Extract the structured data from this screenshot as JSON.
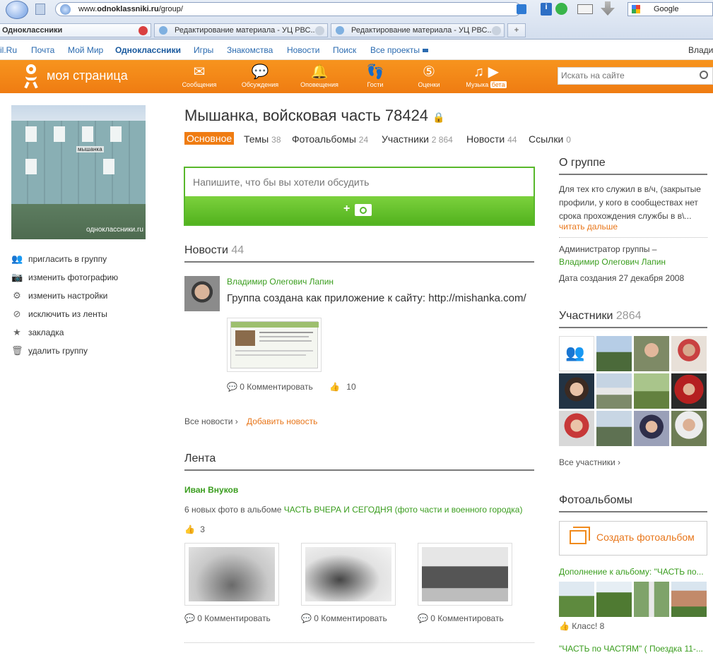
{
  "browser": {
    "url_prefix": "www.",
    "url_domain": "odnoklassniki.ru",
    "url_path": "/group/",
    "search_engine": "Google",
    "tabs": [
      {
        "label": "Одноклассники"
      },
      {
        "label": "Редактирование материала - УЦ РВС..."
      },
      {
        "label": "Редактирование материала - УЦ РВС..."
      }
    ]
  },
  "portal_nav": {
    "items": [
      "il.Ru",
      "Почта",
      "Мой Мир",
      "Одноклассники",
      "Игры",
      "Знакомства",
      "Новости",
      "Поиск",
      "Все проекты"
    ],
    "user": "Влади"
  },
  "header": {
    "logo": "моя страница",
    "nav": [
      {
        "label": "Сообщения",
        "icon": "envelope-icon"
      },
      {
        "label": "Обсуждения",
        "icon": "discussions-icon"
      },
      {
        "label": "Оповещения",
        "icon": "bell-icon"
      },
      {
        "label": "Гости",
        "icon": "footprints-icon"
      },
      {
        "label": "Оценки",
        "icon": "rating-icon"
      },
      {
        "label": "Музыка",
        "icon": "music-icon",
        "badge": "бета"
      }
    ],
    "search_placeholder": "Искать на сайте"
  },
  "group": {
    "title": "Мышанка, войсковая часть 78424",
    "photo_caption": "одноклассники.ru",
    "building_sign": "мышанка"
  },
  "left_menu": [
    {
      "label": "пригласить в группу",
      "icon": "invite-icon"
    },
    {
      "label": "изменить фотографию",
      "icon": "camera-icon"
    },
    {
      "label": "изменить настройки",
      "icon": "gear-icon"
    },
    {
      "label": "исключить из ленты",
      "icon": "exclude-icon"
    },
    {
      "label": "закладка",
      "icon": "star-icon"
    },
    {
      "label": "удалить группу",
      "icon": "trash-icon"
    }
  ],
  "tabs": [
    {
      "label": "Основное",
      "count": ""
    },
    {
      "label": "Темы",
      "count": "38"
    },
    {
      "label": "Фотоальбомы",
      "count": "24"
    },
    {
      "label": "Участники",
      "count": "2 864"
    },
    {
      "label": "Новости",
      "count": "44"
    },
    {
      "label": "Ссылки",
      "count": "0"
    }
  ],
  "composer": {
    "placeholder": "Напишите, что бы вы хотели обсудить",
    "add_photo": "+"
  },
  "news": {
    "title": "Новости",
    "count": "44",
    "post": {
      "author": "Владимир Олегович Лапин",
      "text": "Группа создана как приложение к сайту: http://mishanka.com/",
      "comment": "0 Комментировать",
      "likes": "10"
    },
    "all_link": "Все новости ›",
    "add_link": "Добавить новость"
  },
  "feed": {
    "title": "Лента",
    "author": "Иван Внуков",
    "text_prefix": "6 новых фото в альбоме",
    "album": "ЧАСТЬ ВЧЕРА И СЕГОДНЯ (фото части и военного городка)",
    "likes": "3",
    "comments": [
      "0 Комментировать",
      "0 Комментировать",
      "0 Комментировать"
    ]
  },
  "about": {
    "title": "О группе",
    "text": "Для тех кто служил в в/ч, (закрытые профили, у кого в сообществах нет срока прохождения службы в в\\...",
    "read_more": "читать дальше",
    "admin_label": "Администратор группы –",
    "admin_name": "Владимир Олегович Лапин",
    "created": "Дата создания 27 декабря 2008"
  },
  "members": {
    "title": "Участники",
    "count": "2864",
    "all_link": "Все участники ›"
  },
  "albums": {
    "title": "Фотоальбомы",
    "create": "Создать фотоальбом",
    "addition": "Дополнение к альбому: \"ЧАСТЬ по...",
    "likes": "Класс! 8",
    "next": "\"ЧАСТЬ по ЧАСТЯМ\" ( Поездка 11-..."
  },
  "colors": {
    "orange": "#f08a1c",
    "green": "#3a9d1e",
    "link_blue": "#2b6bb0"
  }
}
